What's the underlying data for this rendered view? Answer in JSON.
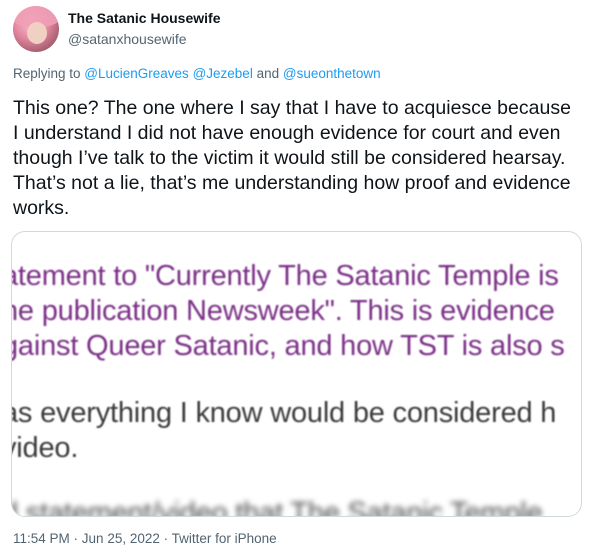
{
  "user": {
    "display_name": "The Satanic Housewife",
    "handle": "@satanxhousewife"
  },
  "reply": {
    "prefix": "Replying to ",
    "mention_1": "@LucienGreaves",
    "mention_2": "@Jezebel",
    "joiner": " and ",
    "mention_3": "@sueonthetown"
  },
  "tweet_text": "This one? The one where I say that I have to acquiesce because I understand I did not have enough evidence for court and even though I’ve talk to the victim it would still be considered hearsay. That’s not a lie, that’s me understanding how proof and evidence works.",
  "media": {
    "lines": [
      "atement to \"Currently The Satanic Temple is",
      "he publication Newsweek\". This is evidence",
      "gainst Queer Satanic, and how TST is also s",
      "as everything I know would be considered h",
      "video.",
      "d statement/video that The Satanic Temple"
    ]
  },
  "meta": {
    "time": "11:54 PM",
    "sep1": " · ",
    "date": "Jun 25, 2022",
    "sep2": " · ",
    "source": "Twitter for iPhone"
  }
}
